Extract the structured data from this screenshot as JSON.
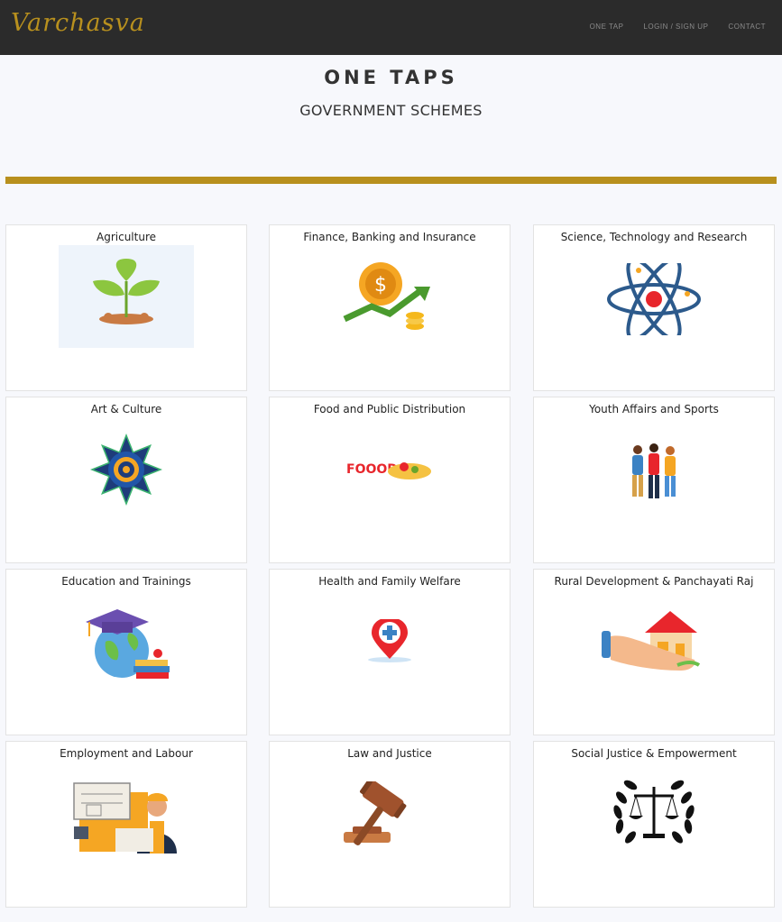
{
  "nav": {
    "logo_text": "Varchasva",
    "links": [
      "ONE TAP",
      "LOGIN / SIGN UP",
      "CONTACT"
    ]
  },
  "header": {
    "title": "ONE TAPS",
    "subtitle": "GOVERNMENT SCHEMES"
  },
  "colors": {
    "navbar_bg": "#2b2b2b",
    "accent_gold": "#b8901e",
    "page_bg": "#f7f8fc"
  },
  "categories": [
    {
      "title": "Agriculture",
      "icon": "plant-sprout-icon"
    },
    {
      "title": "Finance, Banking and Insurance",
      "icon": "coin-growth-arrow-icon"
    },
    {
      "title": "Science, Technology and Research",
      "icon": "atom-icon"
    },
    {
      "title": "Art & Culture",
      "icon": "mandala-icon"
    },
    {
      "title": "Food and Public Distribution",
      "icon": "food-plate-icon"
    },
    {
      "title": "Youth Affairs and Sports",
      "icon": "youth-group-icon"
    },
    {
      "title": "Education and Trainings",
      "icon": "graduation-globe-icon"
    },
    {
      "title": "Health and Family Welfare",
      "icon": "health-location-pin-icon"
    },
    {
      "title": "Rural Development & Panchayati Raj",
      "icon": "hand-house-icon"
    },
    {
      "title": "Employment and Labour",
      "icon": "worker-blueprint-icon"
    },
    {
      "title": "Law and Justice",
      "icon": "gavel-icon"
    },
    {
      "title": "Social Justice & Empowerment",
      "icon": "scales-laurel-icon"
    }
  ],
  "food_icon_text": "FOOOD"
}
